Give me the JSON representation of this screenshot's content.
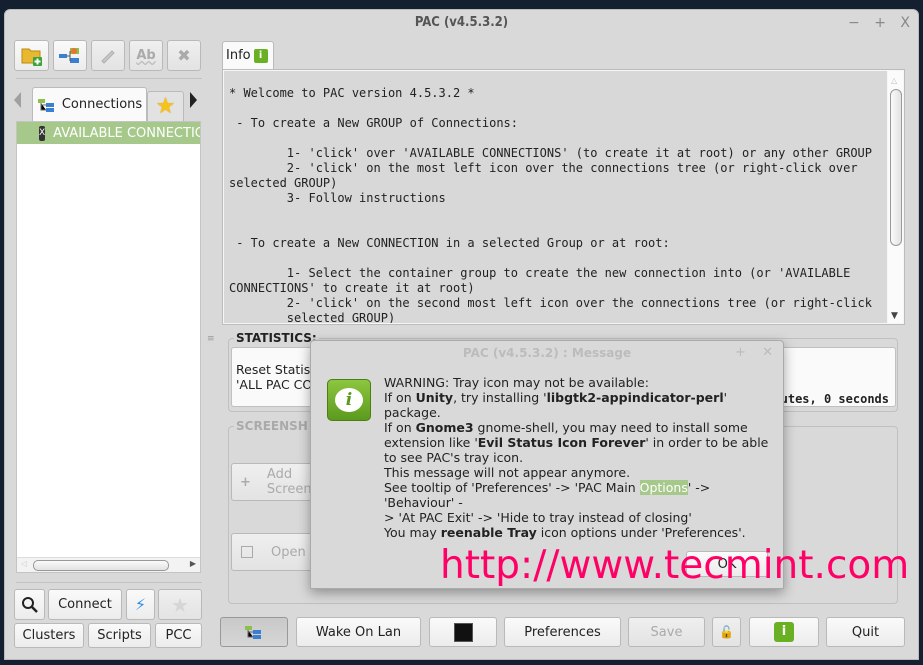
{
  "window": {
    "title": "PAC (v4.5.3.2)",
    "controls": {
      "minimize": "−",
      "maximize": "+",
      "close": "X"
    }
  },
  "left_toolbar": {
    "buttons": [
      {
        "name": "add-group",
        "icon": "folder-add-icon",
        "enabled": true
      },
      {
        "name": "add-connection",
        "icon": "connection-tree-icon",
        "enabled": true
      },
      {
        "name": "edit",
        "icon": "pencil-icon",
        "enabled": false
      },
      {
        "name": "rename",
        "icon": "rename-ab-icon",
        "label": "Ab",
        "enabled": false
      },
      {
        "name": "delete",
        "icon": "x-delete-icon",
        "label": "✖",
        "enabled": false
      }
    ]
  },
  "left_tabs": {
    "items": [
      {
        "label": "Connections",
        "icon": "connections-tree-icon",
        "active": true
      },
      {
        "label": "",
        "icon": "star-favourites-icon",
        "active": false
      }
    ]
  },
  "tree": {
    "items": [
      {
        "label": "AVAILABLE CONNECTIONS",
        "icon": "root-group-icon",
        "selected": true
      }
    ]
  },
  "left_bottom": {
    "search_icon": "search-icon",
    "connect_label": "Connect",
    "quick_connect_icon": "lightning-icon",
    "favourite_icon": "star-icon",
    "clusters_label": "Clusters",
    "clusters_mnemonic": "l",
    "scripts_label": "Scripts",
    "pcc_label": "PCC"
  },
  "info_tab": {
    "label": "Info",
    "icon": "info-bubble-icon",
    "text": "* Welcome to PAC version 4.5.3.2 *\n\n - To create a New GROUP of Connections:\n\n        1- 'click' over 'AVAILABLE CONNECTIONS' (to create it at root) or any other GROUP\n        2- 'click' on the most left icon over the connections tree (or right-click over\nselected GROUP)\n        3- Follow instructions\n\n\n - To create a New CONNECTION in a selected Group or at root:\n\n        1- Select the container group to create the new connection into (or 'AVAILABLE\nCONNECTIONS' to create it at root)\n        2- 'click' on the second most left icon over the connections tree (or right-click\n        selected GROUP)"
  },
  "statistics": {
    "label": "STATISTICS:",
    "line1": "Reset Statist",
    "line2": "'ALL PAC CO",
    "time_suffix": "utes, 0 seconds"
  },
  "screenshots": {
    "label": "SCREENSH",
    "add_label_line1": "Add",
    "add_label_line2": "Screen",
    "open_label": "Open F"
  },
  "bottom_bar": {
    "tree_toggle_icon": "connections-tree-icon",
    "wake_on_lan": "Wake On Lan",
    "terminal_icon": "terminal-icon",
    "preferences": "Preferences",
    "save": "Save",
    "lock_icon": "lock-icon",
    "about_icon": "info-bubble-icon",
    "quit": "Quit"
  },
  "dialog": {
    "title": "PAC (v4.5.3.2) : Message",
    "controls": {
      "maximize": "+",
      "close": "✕"
    },
    "icon": "info-bubble-icon",
    "message": {
      "l1": "WARNING: Tray icon may not be available:",
      "l2a": "If on ",
      "l2b": "Unity",
      "l2c": ", try installing '",
      "l2d": "libgtk2-appindicator-perl",
      "l2e": "'",
      "l3": "package.",
      "l4a": "If on ",
      "l4b": "Gnome3",
      "l4c": " gnome-shell, you may need to install some",
      "l5a": "extension like '",
      "l5b": "Evil Status Icon Forever",
      "l5c": "' in order to be able",
      "l6": "to see PAC's tray icon.",
      "l7": "This message will not appear anymore.",
      "l8a": "See tooltip of 'Preferences' -> 'PAC Main ",
      "l8b": "Options",
      "l8c": "' -> 'Behaviour' -",
      "l9": "> 'At PAC Exit' -> 'Hide to tray instead of closing'",
      "l10a": "You may ",
      "l10b": "reenable Tray",
      "l10c": " icon options under 'Preferences'."
    },
    "ok_label": "OK"
  },
  "watermark": "http://www.tecmint.com"
}
